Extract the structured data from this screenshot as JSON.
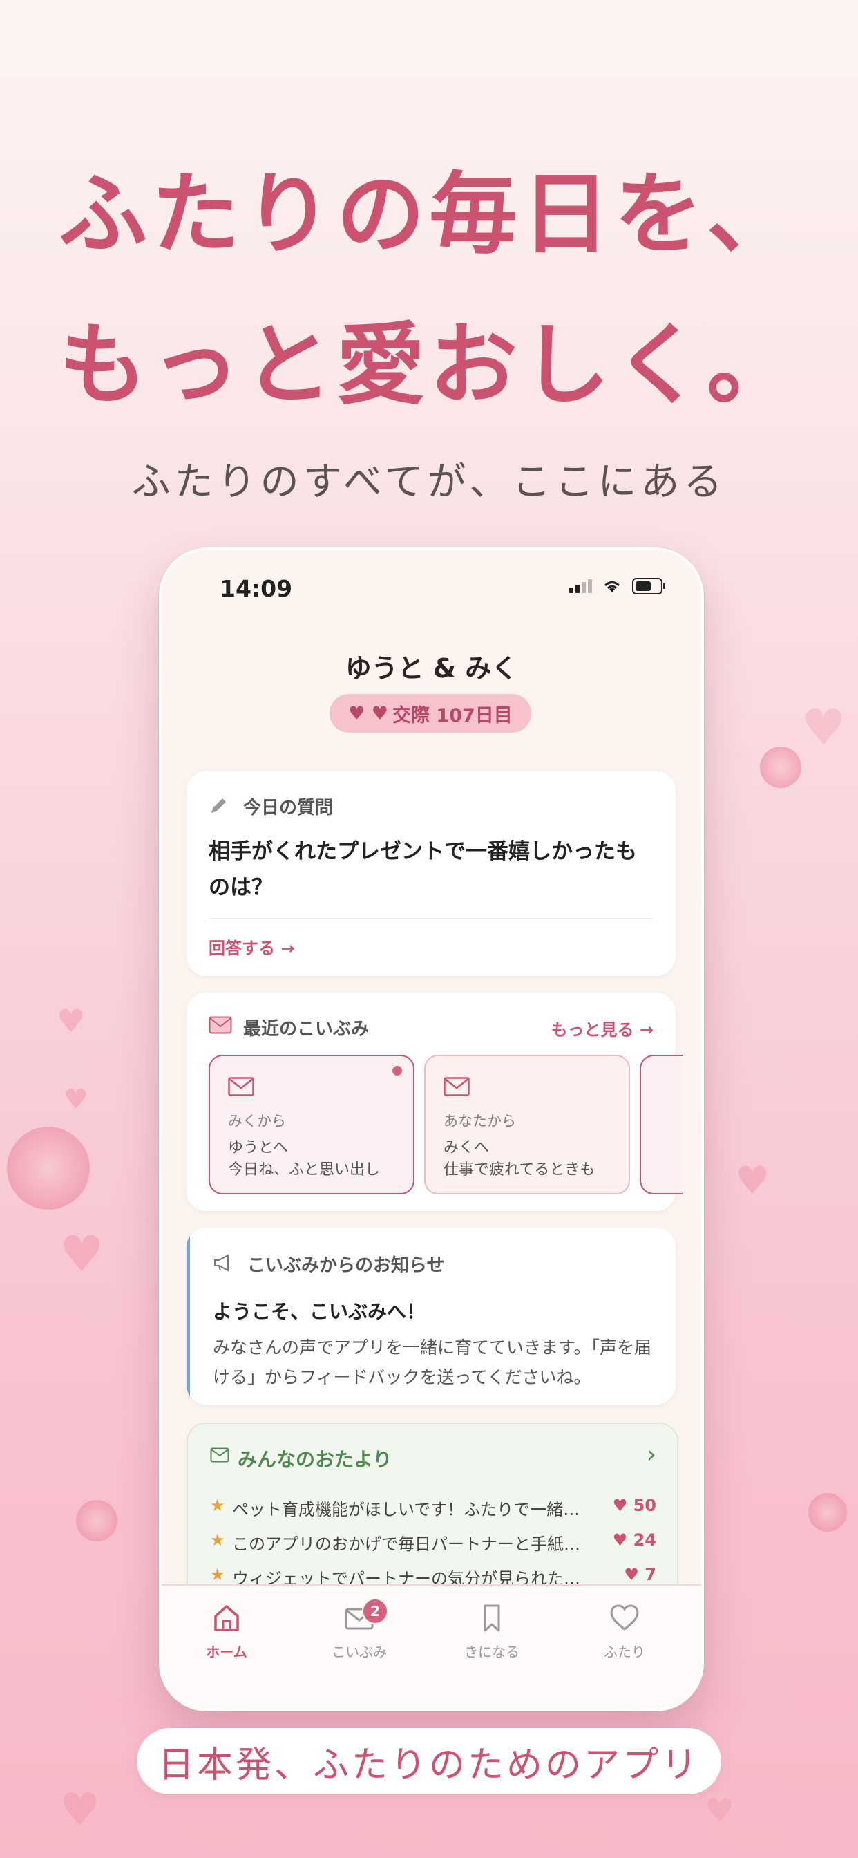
{
  "hero": {
    "line1": "ふたりの毎日を、",
    "line2": "もっと愛おしく。",
    "subtitle": "ふたりのすべてが、ここにある"
  },
  "status_bar": {
    "time": "14:09"
  },
  "header": {
    "couple_names": "ゆうと & みく",
    "days_badge": "交際 107日目"
  },
  "question_card": {
    "label": "今日の質問",
    "question": "相手がくれたプレゼントで一番嬉しかったものは？",
    "answer_link": "回答する →"
  },
  "koibumi_card": {
    "title": "最近のこいぶみ",
    "more_link": "もっと見る →",
    "letters": [
      {
        "from": "みくから",
        "to": "ゆうとへ",
        "preview": "今日ね、ふと思い出し",
        "unread": true
      },
      {
        "from": "あなたから",
        "to": "みくへ",
        "preview": "仕事で疲れてるときも",
        "unread": false
      }
    ]
  },
  "notice_card": {
    "label": "こいぶみからのお知らせ",
    "title": "ようこそ、こいぶみへ！",
    "body": "みなさんの声でアプリを一緒に育てていきます。「声を届ける」からフィードバックを送ってくださいね。"
  },
  "community_card": {
    "title": "みんなのおたより",
    "chevron": "›",
    "items": [
      {
        "text": "ペット育成機能がほしいです！ふたりで一緒に…",
        "likes": "50"
      },
      {
        "text": "このアプリのおかげで毎日パートナーと手紙を…",
        "likes": "24"
      },
      {
        "text": "ウィジェットでパートナーの気分が見られたら嬉…",
        "likes": "7"
      }
    ]
  },
  "tabbar": {
    "tabs": [
      {
        "label": "ホーム",
        "icon": "home-icon",
        "active": true
      },
      {
        "label": "こいぶみ",
        "icon": "mail-icon",
        "badge": "2"
      },
      {
        "label": "きになる",
        "icon": "bookmark-icon"
      },
      {
        "label": "ふたり",
        "icon": "heart-icon"
      }
    ]
  },
  "tagline": "日本発、ふたりのためのアプリ",
  "colors": {
    "accent": "#cc5370",
    "background": "#fbeaea",
    "notice_bar": "#7ba2cf",
    "community_green": "#4f8a4e"
  }
}
